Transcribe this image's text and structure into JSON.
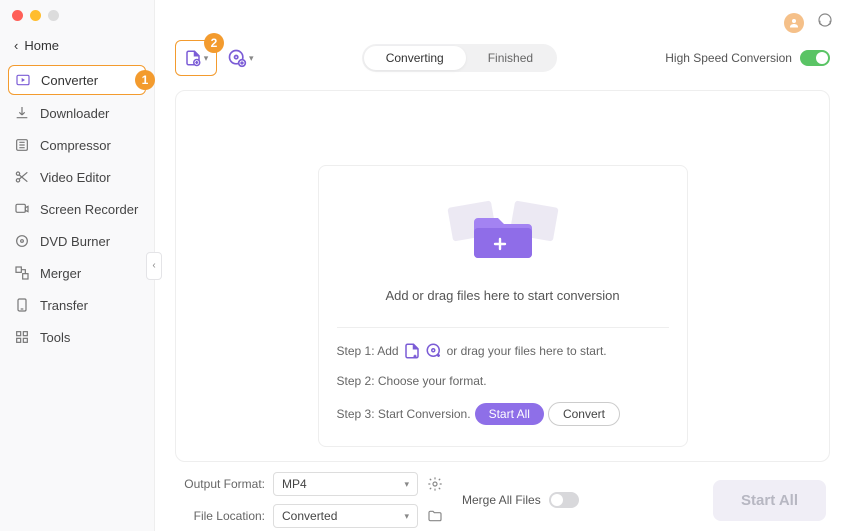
{
  "titlebar": {
    "avatar_initial": ""
  },
  "sidebar": {
    "home": "Home",
    "items": [
      {
        "label": "Converter"
      },
      {
        "label": "Downloader"
      },
      {
        "label": "Compressor"
      },
      {
        "label": "Video Editor"
      },
      {
        "label": "Screen Recorder"
      },
      {
        "label": "DVD Burner"
      },
      {
        "label": "Merger"
      },
      {
        "label": "Transfer"
      },
      {
        "label": "Tools"
      }
    ]
  },
  "annotations": {
    "badge1": "1",
    "badge2": "2"
  },
  "toolbar": {
    "tabs": {
      "converting": "Converting",
      "finished": "Finished"
    },
    "high_speed_label": "High Speed Conversion"
  },
  "dropzone": {
    "main_text": "Add or drag files here to start conversion",
    "step1_pre": "Step 1: Add",
    "step1_post": "or drag your files here to start.",
    "step2": "Step 2: Choose your format.",
    "step3_pre": "Step 3: Start Conversion.",
    "start_all_btn": "Start  All",
    "convert_btn": "Convert"
  },
  "footer": {
    "output_format_label": "Output Format:",
    "output_format_value": "MP4",
    "file_location_label": "File Location:",
    "file_location_value": "Converted",
    "merge_label": "Merge All Files",
    "start_all": "Start All"
  }
}
